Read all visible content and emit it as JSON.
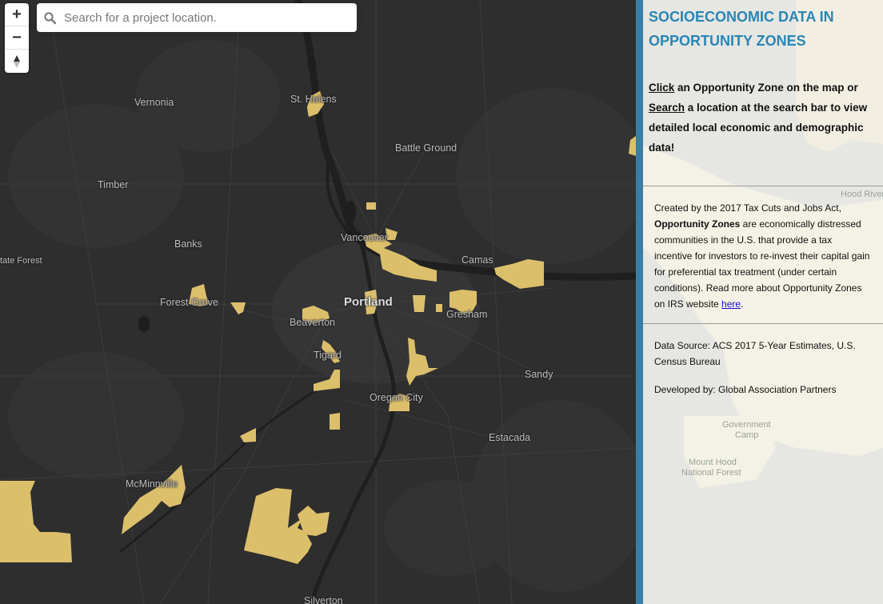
{
  "search": {
    "placeholder": "Search for a project location."
  },
  "zoom": {
    "in_label": "+",
    "out_label": "−"
  },
  "map": {
    "zone_color": "#dcbf6b",
    "cities": {
      "vernonia": "Vernonia",
      "st_helens": "St. Helens",
      "battle_ground": "Battle Ground",
      "timber": "Timber",
      "banks": "Banks",
      "state_forest": "tate Forest",
      "vancouver": "Vancouver",
      "camas": "Camas",
      "forest_grove": "Forest Grove",
      "portland": "Portland",
      "beaverton": "Beaverton",
      "gresham": "Gresham",
      "tigard": "Tigard",
      "sandy": "Sandy",
      "oregon_city": "Oregon City",
      "estacada": "Estacada",
      "mcminnville": "McMinnville",
      "silverton": "Silverton"
    }
  },
  "panel": {
    "accent_color": "#3a7ea4",
    "title": "SOCIOECONOMIC DATA IN OPPORTUNITY ZONES",
    "intro": {
      "click": "Click",
      "text1": " an Opportunity Zone on the map or ",
      "search": "Search",
      "text2": " a location at the search bar to view detailed local economic and demographic data!"
    },
    "description": {
      "before": "Created by the 2017 Tax Cuts and Jobs Act, ",
      "bold": "Opportunity Zones",
      "after": " are economically distressed communities in the U.S. that provide a tax incentive for investors to re-invest their capital gain for preferential tax treatment (under certain conditions). Read more about Opportunity Zones on IRS website ",
      "link": "here",
      "end": "."
    },
    "data_source": "Data Source: ACS 2017 5-Year Estimates, U.S. Census Bureau",
    "developed_by": "Developed by: Global Association Partners",
    "bg_labels": {
      "hood_river": "Hood River",
      "gov_camp_1": "Government",
      "gov_camp_2": "Camp",
      "mt_hood_1": "Mount Hood",
      "mt_hood_2": "National Forest"
    }
  }
}
